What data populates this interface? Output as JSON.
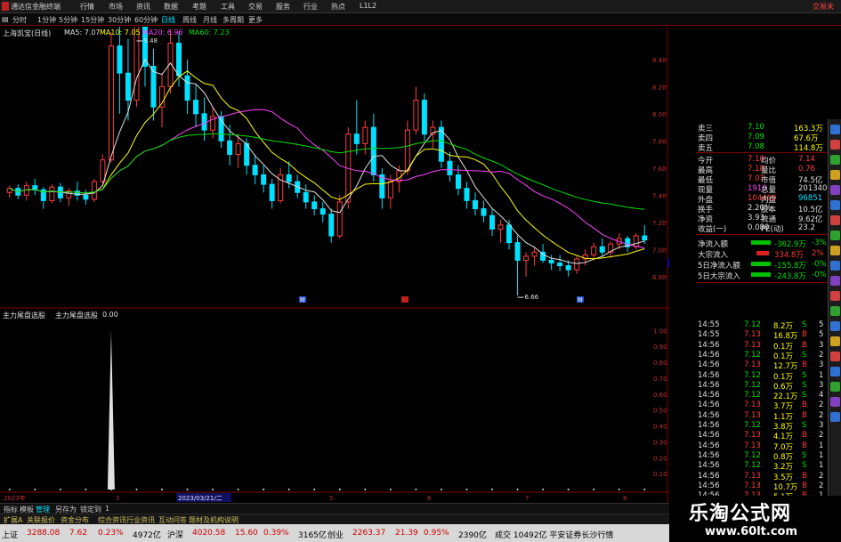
{
  "app": {
    "title": "通达信金融终端",
    "trade_label": "交易未"
  },
  "menu": [
    "行情",
    "市场",
    "资讯",
    "数据",
    "考题",
    "工具",
    "交易",
    "服务",
    "行业",
    "热点",
    "L1L2"
  ],
  "periods": [
    {
      "label": "分时",
      "active": false
    },
    {
      "label": "1分钟",
      "active": false
    },
    {
      "label": "5分钟",
      "active": false
    },
    {
      "label": "15分钟",
      "active": false
    },
    {
      "label": "30分钟",
      "active": false
    },
    {
      "label": "60分钟",
      "active": false
    },
    {
      "label": "日线",
      "active": true
    },
    {
      "label": "周线",
      "active": false
    },
    {
      "label": "月线",
      "active": false
    },
    {
      "label": "多周期",
      "active": false
    },
    {
      "label": "更多",
      "active": false
    }
  ],
  "chart_header": {
    "stock": "上海凯宝(日线)",
    "ma5": "MA5: 7.07",
    "ma10": "MA10: 7.05",
    "ma20": "MA20: 6.96",
    "ma60": "MA60: 7.23"
  },
  "colors": {
    "up": "#ff3c3c",
    "down": "#00e0ff",
    "ma5": "#e0e0e0",
    "ma10": "#ffff00",
    "ma20": "#ff40ff",
    "ma60": "#00e000",
    "grid": "#800000"
  },
  "chart_data": {
    "type": "candlestick",
    "y_axis_labels": [
      "8.40",
      "8.20",
      "8.00",
      "7.80",
      "7.60",
      "7.40",
      "7.20",
      "7.00",
      "6.80"
    ],
    "ylim": [
      6.7,
      8.55
    ],
    "annotations": {
      "high": "9.48",
      "low": "6.66"
    },
    "current_price_marker": "6.90",
    "ma_legend": [
      "MA5",
      "MA10",
      "MA20",
      "MA60"
    ],
    "candles": [
      [
        7.42,
        7.47,
        7.38,
        7.45
      ],
      [
        7.45,
        7.48,
        7.37,
        7.4
      ],
      [
        7.4,
        7.5,
        7.36,
        7.47
      ],
      [
        7.47,
        7.52,
        7.4,
        7.44
      ],
      [
        7.44,
        7.46,
        7.3,
        7.36
      ],
      [
        7.36,
        7.48,
        7.34,
        7.46
      ],
      [
        7.46,
        7.49,
        7.35,
        7.38
      ],
      [
        7.38,
        7.45,
        7.32,
        7.43
      ],
      [
        7.43,
        7.5,
        7.36,
        7.4
      ],
      [
        7.4,
        7.44,
        7.33,
        7.37
      ],
      [
        7.37,
        7.52,
        7.35,
        7.5
      ],
      [
        7.5,
        7.7,
        7.48,
        7.66
      ],
      [
        7.66,
        8.6,
        7.64,
        8.5
      ],
      [
        8.5,
        8.78,
        8.0,
        8.3
      ],
      [
        8.3,
        8.55,
        7.95,
        8.1
      ],
      [
        8.1,
        8.92,
        8.05,
        8.75
      ],
      [
        8.75,
        8.85,
        8.2,
        8.35
      ],
      [
        8.35,
        8.48,
        7.95,
        8.05
      ],
      [
        8.05,
        8.3,
        7.9,
        8.2
      ],
      [
        8.2,
        8.62,
        8.15,
        8.52
      ],
      [
        8.52,
        8.6,
        8.2,
        8.28
      ],
      [
        8.28,
        8.4,
        8.0,
        8.1
      ],
      [
        8.1,
        8.22,
        7.9,
        8.0
      ],
      [
        8.0,
        8.12,
        7.8,
        7.88
      ],
      [
        7.88,
        8.05,
        7.82,
        7.98
      ],
      [
        7.98,
        8.02,
        7.75,
        7.8
      ],
      [
        7.8,
        7.92,
        7.62,
        7.7
      ],
      [
        7.7,
        7.85,
        7.6,
        7.78
      ],
      [
        7.78,
        7.82,
        7.55,
        7.62
      ],
      [
        7.62,
        7.7,
        7.48,
        7.55
      ],
      [
        7.55,
        7.62,
        7.42,
        7.48
      ],
      [
        7.48,
        7.52,
        7.3,
        7.36
      ],
      [
        7.36,
        7.6,
        7.34,
        7.55
      ],
      [
        7.55,
        7.65,
        7.45,
        7.5
      ],
      [
        7.5,
        7.55,
        7.38,
        7.42
      ],
      [
        7.42,
        7.48,
        7.3,
        7.35
      ],
      [
        7.35,
        7.4,
        7.25,
        7.3
      ],
      [
        7.3,
        7.35,
        7.2,
        7.26
      ],
      [
        7.26,
        7.3,
        7.05,
        7.1
      ],
      [
        7.1,
        7.4,
        7.08,
        7.35
      ],
      [
        7.35,
        7.9,
        7.3,
        7.85
      ],
      [
        7.85,
        8.1,
        7.7,
        7.78
      ],
      [
        7.78,
        7.95,
        7.7,
        7.9
      ],
      [
        7.9,
        8.0,
        7.5,
        7.55
      ],
      [
        7.55,
        7.6,
        7.3,
        7.38
      ],
      [
        7.38,
        7.55,
        7.3,
        7.5
      ],
      [
        7.5,
        7.62,
        7.42,
        7.58
      ],
      [
        7.58,
        7.95,
        7.55,
        7.88
      ],
      [
        7.88,
        8.2,
        7.85,
        8.1
      ],
      [
        8.1,
        8.15,
        7.8,
        7.85
      ],
      [
        7.85,
        7.95,
        7.75,
        7.9
      ],
      [
        7.9,
        7.95,
        7.6,
        7.65
      ],
      [
        7.65,
        7.72,
        7.5,
        7.55
      ],
      [
        7.55,
        7.62,
        7.4,
        7.45
      ],
      [
        7.45,
        7.5,
        7.3,
        7.36
      ],
      [
        7.36,
        7.42,
        7.25,
        7.3
      ],
      [
        7.3,
        7.36,
        7.2,
        7.25
      ],
      [
        7.25,
        7.3,
        7.1,
        7.15
      ],
      [
        7.15,
        7.22,
        7.05,
        7.18
      ],
      [
        7.18,
        7.22,
        7.0,
        7.05
      ],
      [
        7.05,
        7.1,
        6.66,
        6.92
      ],
      [
        6.92,
        6.98,
        6.8,
        6.95
      ],
      [
        6.95,
        7.02,
        6.88,
        6.98
      ],
      [
        6.98,
        7.04,
        6.9,
        6.92
      ],
      [
        6.92,
        6.96,
        6.85,
        6.9
      ],
      [
        6.9,
        6.96,
        6.84,
        6.88
      ],
      [
        6.88,
        6.92,
        6.8,
        6.85
      ],
      [
        6.85,
        6.95,
        6.82,
        6.93
      ],
      [
        6.93,
        7.0,
        6.88,
        6.96
      ],
      [
        6.96,
        7.05,
        6.92,
        7.02
      ],
      [
        7.02,
        7.08,
        6.95,
        6.98
      ],
      [
        6.98,
        7.06,
        6.94,
        7.04
      ],
      [
        7.04,
        7.12,
        7.0,
        7.08
      ],
      [
        7.08,
        7.1,
        6.98,
        7.02
      ],
      [
        7.02,
        7.12,
        7.0,
        7.1
      ],
      [
        7.1,
        7.18,
        7.04,
        7.07
      ]
    ],
    "volume_markers": [
      "财",
      "",
      "财"
    ],
    "indicator": {
      "name": "主力尾盘选股",
      "legend": "主力尾盘选股",
      "value": "0.00",
      "y_axis_labels": [
        "1.00",
        "0.90",
        "0.80",
        "0.70",
        "0.60",
        "0.50",
        "0.40",
        "0.30",
        "0.20",
        "0.10"
      ],
      "ylim": [
        0,
        1.08
      ],
      "spike_index": 12,
      "x_labels": [
        "2023年",
        "3",
        "2023/03/21/二",
        "5",
        "6",
        "7",
        "8"
      ]
    }
  },
  "order_book": [
    {
      "label": "卖三",
      "price": "7.10",
      "vol": "163.3万"
    },
    {
      "label": "卖四",
      "price": "7.09",
      "vol": "67.6万"
    },
    {
      "label": "卖五",
      "price": "7.08",
      "vol": "114.8万"
    }
  ],
  "quote_stats": [
    {
      "l1": "今开",
      "v1": "7.10",
      "l2": "均价",
      "v2": "7.14"
    },
    {
      "l1": "最高",
      "v1": "7.18",
      "l2": "量比",
      "v2": "0.76"
    },
    {
      "l1": "最低",
      "v1": "7.07",
      "l2": "市值",
      "v2": "74.5亿"
    },
    {
      "l1": "现量",
      "v1": "1910",
      "l2": "总量",
      "v2": "201340"
    },
    {
      "l1": "外盘",
      "v1": "104469",
      "l2": "内盘",
      "v2": "96851"
    },
    {
      "l1": "换手",
      "v1": "2.20%",
      "l2": "股本",
      "v2": "10.5亿"
    },
    {
      "l1": "净资",
      "v1": "3.93",
      "l2": "流通",
      "v2": "9.62亿"
    },
    {
      "l1": "收益(一)",
      "v1": "0.080",
      "l2": "PE(动)",
      "v2": "23.2"
    }
  ],
  "capital_flow": [
    {
      "label": "净流入额",
      "value": "-362.9万",
      "pct": "-3%"
    },
    {
      "label": "大宗流入",
      "value": "334.8万",
      "pct": "2%"
    },
    {
      "label": "5日净流入额",
      "value": "-155.8万",
      "pct": "-0%"
    },
    {
      "label": "5日大宗流入",
      "value": "-243.8万",
      "pct": "-0%"
    }
  ],
  "ticks": [
    {
      "time": "14:55",
      "price": "7.12",
      "vol": "8.2万",
      "side": "S",
      "n": "5"
    },
    {
      "time": "14:55",
      "price": "7.13",
      "vol": "16.8万",
      "side": "B",
      "n": "5"
    },
    {
      "time": "14:56",
      "price": "7.13",
      "vol": "0.1万",
      "side": "B",
      "n": "3"
    },
    {
      "time": "14:56",
      "price": "7.12",
      "vol": "0.1万",
      "side": "S",
      "n": "2"
    },
    {
      "time": "14:56",
      "price": "7.13",
      "vol": "12.7万",
      "side": "B",
      "n": "3"
    },
    {
      "time": "14:56",
      "price": "7.12",
      "vol": "0.1万",
      "side": "S",
      "n": "1"
    },
    {
      "time": "14:56",
      "price": "7.12",
      "vol": "0.6万",
      "side": "S",
      "n": "3"
    },
    {
      "time": "14:56",
      "price": "7.12",
      "vol": "22.1万",
      "side": "S",
      "n": "4"
    },
    {
      "time": "14:56",
      "price": "7.13",
      "vol": "3.7万",
      "side": "B",
      "n": "2"
    },
    {
      "time": "14:56",
      "price": "7.13",
      "vol": "1.1万",
      "side": "B",
      "n": "2"
    },
    {
      "time": "14:56",
      "price": "7.12",
      "vol": "3.8万",
      "side": "S",
      "n": "3"
    },
    {
      "time": "14:56",
      "price": "7.13",
      "vol": "4.1万",
      "side": "B",
      "n": "2"
    },
    {
      "time": "14:56",
      "price": "7.13",
      "vol": "7.0万",
      "side": "B",
      "n": "1"
    },
    {
      "time": "14:56",
      "price": "7.12",
      "vol": "0.8万",
      "side": "S",
      "n": "1"
    },
    {
      "time": "14:56",
      "price": "7.12",
      "vol": "3.2万",
      "side": "S",
      "n": "1"
    },
    {
      "time": "14:56",
      "price": "7.13",
      "vol": "3.5万",
      "side": "B",
      "n": "2"
    },
    {
      "time": "14:56",
      "price": "7.13",
      "vol": "10.7万",
      "side": "B",
      "n": "2"
    },
    {
      "time": "14:56",
      "price": "7.13",
      "vol": "5.1万",
      "side": "B",
      "n": "1"
    }
  ],
  "tabs1": [
    {
      "label": "指标",
      "active": false
    },
    {
      "label": "模板",
      "active": false
    },
    {
      "label": "管理",
      "active": true
    },
    {
      "label": "另存为",
      "active": false
    },
    {
      "label": "锁定到",
      "active": false
    },
    {
      "label": "1",
      "active": false
    }
  ],
  "tabs2": [
    "扩展A",
    "关联报价",
    "资金分布",
    "综合资讯",
    "行业资讯",
    "互动问答",
    "题材及机构说明"
  ],
  "index_bar": [
    {
      "name": "上证",
      "val": "3288.08",
      "chg": "7.62",
      "pct": "0.23%",
      "amt": "4972亿"
    },
    {
      "name": "沪深",
      "val": "4020.58",
      "chg": "15.60",
      "pct": "0.39%",
      "amt": "3165亿"
    },
    {
      "name": "创业",
      "val": "2263.37",
      "chg": "21.39",
      "pct": "0.95%",
      "amt": "2390亿"
    }
  ],
  "index_extra": "成交 10492亿 平安证券长沙行情",
  "watermark": {
    "line1": "乐淘公式网",
    "line2": "www.60lt.com"
  }
}
